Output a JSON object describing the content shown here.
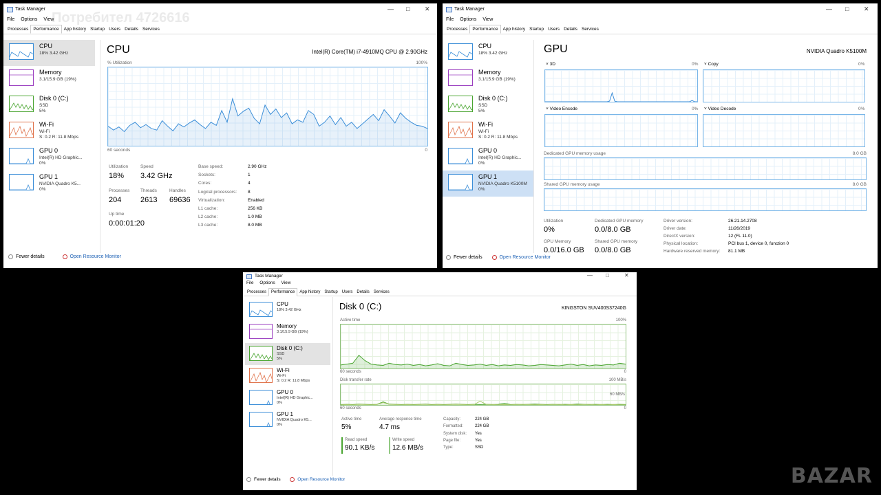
{
  "app_title": "Task Manager",
  "menus": [
    "File",
    "Options",
    "View"
  ],
  "tabs": [
    "Processes",
    "Performance",
    "App history",
    "Startup",
    "Users",
    "Details",
    "Services"
  ],
  "active_tab": "Performance",
  "sidebar": [
    {
      "name": "CPU",
      "line1": "18% 3.42 GHz",
      "line2": "",
      "color": "#3b8ed8"
    },
    {
      "name": "Memory",
      "line1": "3.1/15.9 GB (19%)",
      "line2": "",
      "color": "#9b3fc0"
    },
    {
      "name": "Disk 0 (C:)",
      "line1": "SSD",
      "line2": "5%",
      "color": "#4aa531"
    },
    {
      "name": "Wi-Fi",
      "line1": "Wi-Fi",
      "line2": "S: 0.2  R: 11.8 Mbps",
      "color": "#e0724a"
    },
    {
      "name": "GPU 0",
      "line1": "Intel(R) HD Graphic...",
      "line2": "0%",
      "color": "#3b8ed8"
    },
    {
      "name": "GPU 1",
      "line1": "NVIDIA Quadro K5...",
      "line2": "0%",
      "color": "#3b8ed8"
    }
  ],
  "sidebar_gpu1_full": "NVIDIA Quadro K5100M",
  "footer": {
    "fewer": "Fewer details",
    "monitor": "Open Resource Monitor"
  },
  "watermark": "Потребител 4726616",
  "logo": "BAZAR",
  "cpu": {
    "title": "CPU",
    "device": "Intel(R) Core(TM) i7-4910MQ CPU @ 2.90GHz",
    "graph_label": "% Utilization",
    "graph_max": "100%",
    "graph_time": "60 seconds",
    "graph_min": "0",
    "graph_values": [
      25,
      20,
      24,
      18,
      26,
      30,
      23,
      27,
      22,
      20,
      32,
      25,
      19,
      28,
      24,
      29,
      33,
      27,
      22,
      30,
      26,
      45,
      30,
      60,
      38,
      44,
      48,
      35,
      28,
      52,
      40,
      47,
      36,
      42,
      28,
      33,
      30,
      45,
      40,
      25,
      30,
      38,
      27,
      36,
      25,
      30,
      22,
      28,
      34,
      40,
      32,
      46,
      38,
      29,
      42,
      35,
      30,
      26,
      25,
      22
    ],
    "utilization_label": "Utilization",
    "utilization": "18%",
    "speed_label": "Speed",
    "speed": "3.42 GHz",
    "processes_label": "Processes",
    "processes": "204",
    "threads_label": "Threads",
    "threads": "2613",
    "handles_label": "Handles",
    "handles": "69636",
    "uptime_label": "Up time",
    "uptime": "0:00:01:20",
    "specs": [
      {
        "k": "Base speed:",
        "v": "2.90 GHz"
      },
      {
        "k": "Sockets:",
        "v": "1"
      },
      {
        "k": "Cores:",
        "v": "4"
      },
      {
        "k": "Logical processors:",
        "v": "8"
      },
      {
        "k": "Virtualization:",
        "v": "Enabled"
      },
      {
        "k": "L1 cache:",
        "v": "256 KB"
      },
      {
        "k": "L2 cache:",
        "v": "1.0 MB"
      },
      {
        "k": "L3 cache:",
        "v": "8.0 MB"
      }
    ]
  },
  "gpu": {
    "title": "GPU",
    "device": "NVIDIA Quadro K5100M",
    "engines": [
      {
        "name": "3D",
        "pct": "0%"
      },
      {
        "name": "Copy",
        "pct": "0%"
      },
      {
        "name": "Video Encode",
        "pct": "0%"
      },
      {
        "name": "Video Decode",
        "pct": "0%"
      }
    ],
    "dedicated_label": "Dedicated GPU memory usage",
    "dedicated_max": "8.0 GB",
    "shared_label": "Shared GPU memory usage",
    "shared_max": "8.0 GB",
    "utilization_label": "Utilization",
    "utilization": "0%",
    "ded_mem_label": "Dedicated GPU memory",
    "ded_mem": "0.0/8.0 GB",
    "gpu_mem_label": "GPU Memory",
    "gpu_mem": "0.0/16.0 GB",
    "shared_mem_label": "Shared GPU memory",
    "shared_mem": "0.0/8.0 GB",
    "specs": [
      {
        "k": "Driver version:",
        "v": "26.21.14.2708"
      },
      {
        "k": "Driver date:",
        "v": "11/26/2019"
      },
      {
        "k": "DirectX version:",
        "v": "12 (FL 11.0)"
      },
      {
        "k": "Physical location:",
        "v": "PCI bus 1, device 0, function 0"
      },
      {
        "k": "Hardware reserved memory:",
        "v": "81.1 MB"
      }
    ]
  },
  "disk": {
    "title": "Disk 0 (C:)",
    "device": "KINGSTON SUV400S37240G",
    "active_label": "Active time",
    "active_max": "100%",
    "time1": "60 seconds",
    "min1": "0",
    "transfer_label": "Disk transfer rate",
    "transfer_max": "100 MB/s",
    "transfer_mark": "60 MB/s",
    "time2": "60 seconds",
    "min2": "0",
    "active_values": [
      8,
      10,
      12,
      30,
      18,
      10,
      8,
      7,
      12,
      9,
      8,
      10,
      7,
      9,
      6,
      8,
      11,
      7,
      6,
      12,
      9,
      7,
      8,
      10,
      7,
      9,
      6,
      8,
      7,
      9,
      8,
      6,
      7,
      9,
      8,
      7,
      6,
      8,
      10,
      7,
      9,
      6,
      8,
      7,
      9,
      8,
      12,
      10
    ],
    "read_values": [
      2,
      3,
      2,
      4,
      3,
      2,
      3,
      15,
      4,
      3,
      2,
      3,
      2,
      3,
      4,
      2,
      3,
      2,
      3,
      4,
      3,
      2,
      3,
      2,
      3,
      2,
      3,
      8,
      2,
      3,
      2,
      3,
      4,
      3,
      2,
      3,
      2,
      3,
      2,
      4,
      3,
      2,
      3,
      2,
      3,
      2,
      3,
      2
    ],
    "write_values": [
      1,
      2,
      1,
      3,
      2,
      1,
      2,
      12,
      3,
      2,
      1,
      2,
      1,
      2,
      3,
      1,
      2,
      1,
      2,
      3,
      2,
      1,
      2,
      18,
      3,
      2,
      1,
      2,
      1,
      2,
      3,
      2,
      1,
      2,
      1,
      2,
      3,
      1,
      2,
      1,
      2,
      3,
      1,
      2,
      1,
      2,
      1,
      1
    ],
    "active_time_label": "Active time",
    "active_time": "5%",
    "resp_label": "Average response time",
    "resp": "4.7 ms",
    "read_label": "Read speed",
    "read": "90.1 KB/s",
    "write_label": "Write speed",
    "write": "12.6 MB/s",
    "specs": [
      {
        "k": "Capacity:",
        "v": "224 GB"
      },
      {
        "k": "Formatted:",
        "v": "224 GB"
      },
      {
        "k": "System disk:",
        "v": "Yes"
      },
      {
        "k": "Page file:",
        "v": "Yes"
      },
      {
        "k": "Type:",
        "v": "SSD"
      }
    ]
  }
}
